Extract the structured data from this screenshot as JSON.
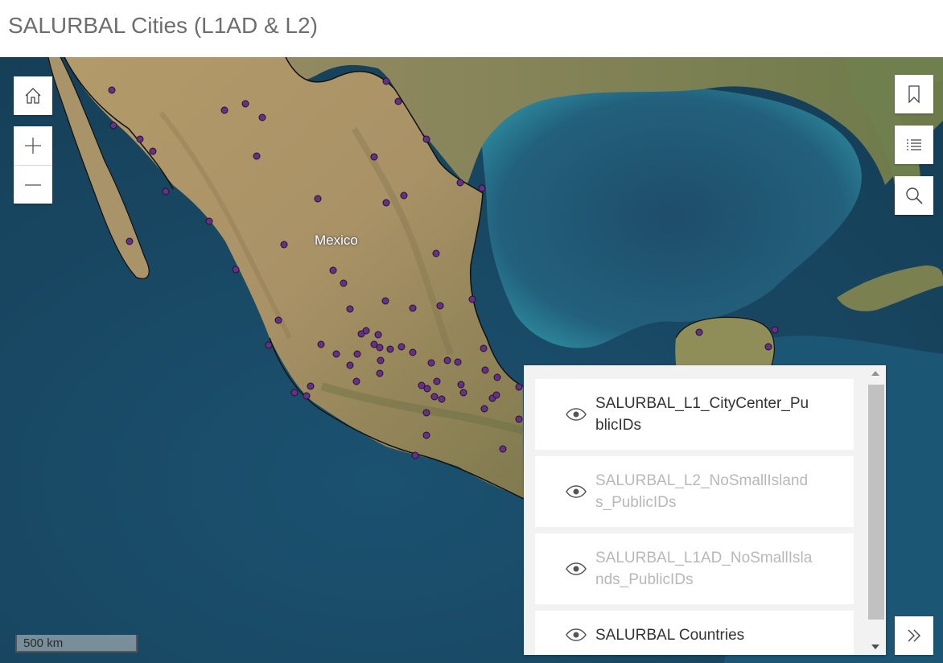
{
  "app": {
    "title": "SALURBAL Cities (L1AD & L2)"
  },
  "map": {
    "country_label": "Mexico",
    "scale_label": "500 km",
    "point_color": "#6b2c91",
    "border_color": "#111111"
  },
  "controls": {
    "home": {
      "icon": "home-icon"
    },
    "zoom_in": {
      "icon": "plus-icon"
    },
    "zoom_out": {
      "icon": "minus-icon"
    },
    "bookmarks": {
      "icon": "bookmark-icon"
    },
    "layer_list": {
      "icon": "list-icon"
    },
    "search": {
      "icon": "search-icon"
    },
    "expand": {
      "icon": "double-chevron-right-icon"
    }
  },
  "layers": [
    {
      "name": "SALURBAL_L1_CityCenter_PublicIDs",
      "visible": true
    },
    {
      "name": "SALURBAL_L2_NoSmallIslands_PublicIDs",
      "visible": false
    },
    {
      "name": "SALURBAL_L1AD_NoSmallIslands_PublicIDs",
      "visible": false
    },
    {
      "name": "SALURBAL Countries",
      "visible": true
    }
  ]
}
